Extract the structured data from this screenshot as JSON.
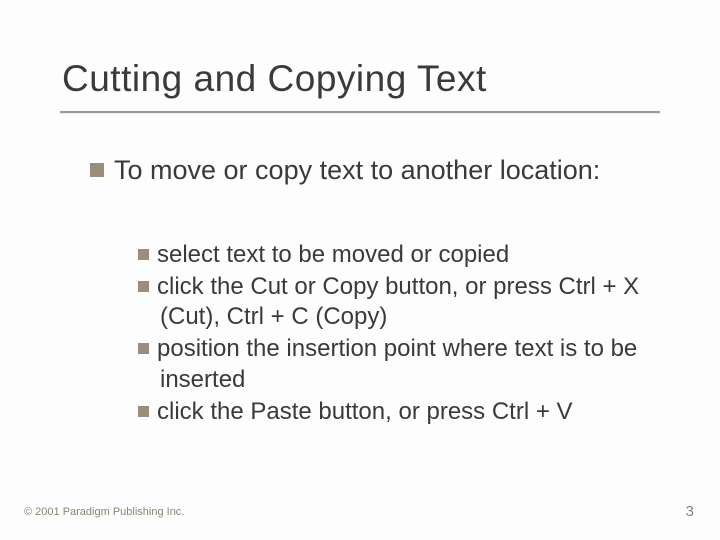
{
  "slide": {
    "title": "Cutting and Copying Text",
    "level1": {
      "text": "To move or copy text to another location:"
    },
    "level2": [
      {
        "text": "select text to be moved or copied"
      },
      {
        "text": "click the Cut or Copy button, or press Ctrl + X (Cut), Ctrl + C (Copy)"
      },
      {
        "text": "position the insertion point where text is to be inserted"
      },
      {
        "text": "click the Paste button, or press Ctrl + V"
      }
    ],
    "footer": {
      "copyright": "© 2001 Paradigm Publishing Inc.",
      "page": "3"
    }
  }
}
